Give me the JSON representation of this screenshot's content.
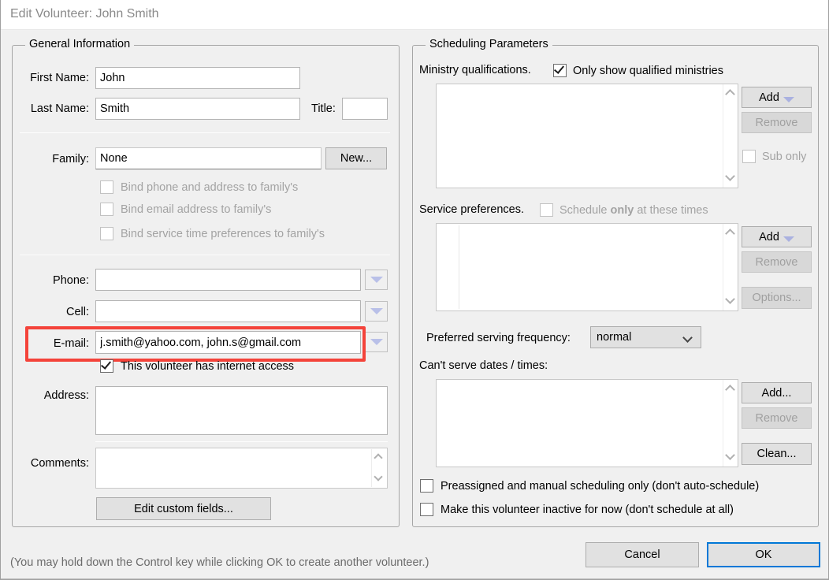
{
  "window": {
    "title": "Edit Volunteer: John Smith"
  },
  "general": {
    "legend": "General Information",
    "first_name_label": "First Name:",
    "first_name_value": "John",
    "last_name_label": "Last Name:",
    "last_name_value": "Smith",
    "title_label": "Title:",
    "title_value": "",
    "family_label": "Family:",
    "family_value": "None",
    "new_button": "New...",
    "bind_phone_address": "Bind phone and address to family's",
    "bind_email": "Bind email address to family's",
    "bind_service_times": "Bind service time preferences to family's",
    "phone_label": "Phone:",
    "phone_value": "",
    "cell_label": "Cell:",
    "cell_value": "",
    "email_label": "E-mail:",
    "email_value": "j.smith@yahoo.com, john.s@gmail.com",
    "internet_access": "This volunteer has internet access",
    "address_label": "Address:",
    "address_value": "",
    "comments_label": "Comments:",
    "comments_value": "",
    "edit_custom_fields": "Edit custom fields..."
  },
  "scheduling": {
    "legend": "Scheduling Parameters",
    "ministry_qualifications_label": "Ministry qualifications.",
    "only_show_qualified": "Only show qualified ministries",
    "ministry_add": "Add",
    "ministry_remove": "Remove",
    "sub_only": "Sub only",
    "service_preferences_label": "Service preferences.",
    "schedule_only_prefix": "Schedule ",
    "schedule_only_bold": "only",
    "schedule_only_suffix": " at these times",
    "pref_add": "Add",
    "pref_remove": "Remove",
    "pref_options": "Options...",
    "frequency_label": "Preferred serving frequency:",
    "frequency_value": "normal",
    "cant_serve_label": "Can't serve dates / times:",
    "cant_add": "Add...",
    "cant_remove": "Remove",
    "cant_clean": "Clean...",
    "preassigned_only": "Preassigned and manual scheduling only (don't auto-schedule)",
    "make_inactive": "Make this volunteer inactive for now (don't schedule at all)"
  },
  "footer": {
    "hint": "(You may hold down the Control key while clicking OK to create another volunteer.)",
    "cancel": "Cancel",
    "ok": "OK"
  },
  "colors": {
    "accent": "#0078d7",
    "annotation": "#f4433a",
    "window_bg": "#f0f0f0"
  }
}
